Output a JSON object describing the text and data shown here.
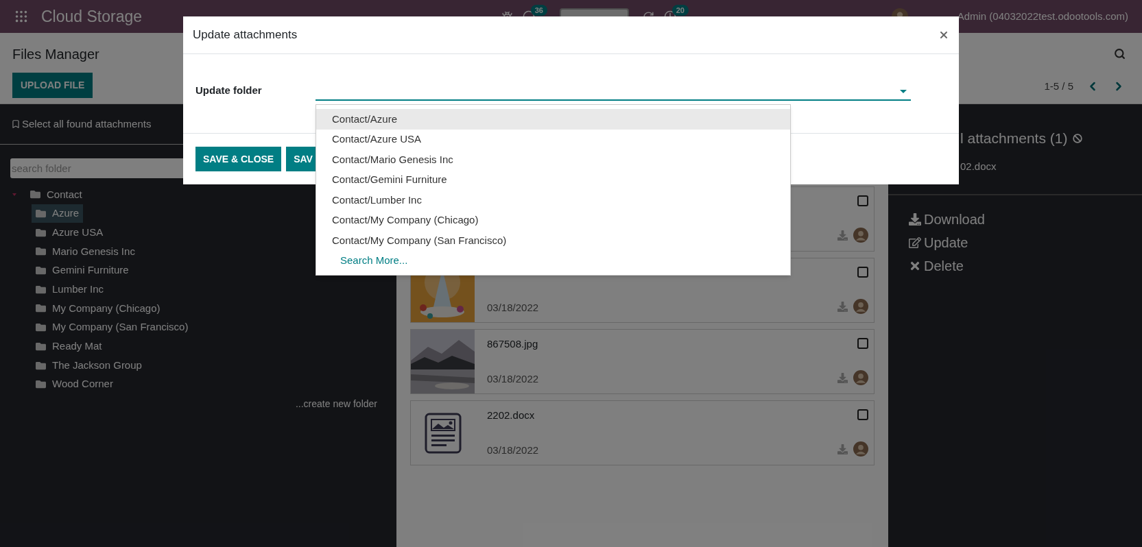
{
  "top_bar": {
    "app_title": "Cloud Storage",
    "badges": [
      {
        "kind": "chat",
        "count": "36"
      },
      {
        "kind": "activity",
        "count": "20"
      }
    ],
    "user": "Admin (04032022test.odootools.com)"
  },
  "control_panel": {
    "title": "Files Manager",
    "upload_button": "UPLOAD FILE",
    "pager": "1-5 / 5"
  },
  "folder_panel": {
    "select_all": "Select all found attachments",
    "search": {
      "placeholder": "search folder"
    },
    "tree": [
      {
        "label": "Contact",
        "expanded": true,
        "selected": false,
        "children": [
          {
            "label": "Azure",
            "selected": true
          },
          {
            "label": "Azure USA",
            "selected": false
          },
          {
            "label": "Mario Genesis Inc",
            "selected": false
          },
          {
            "label": "Gemini Furniture",
            "selected": false
          },
          {
            "label": "Lumber Inc",
            "selected": false
          },
          {
            "label": "My Company (Chicago)",
            "selected": false
          },
          {
            "label": "My Company (San Francisco)",
            "selected": false
          },
          {
            "label": "Ready Mat",
            "selected": false
          },
          {
            "label": "The Jackson Group",
            "selected": false
          },
          {
            "label": "Wood Corner",
            "selected": false
          }
        ]
      }
    ],
    "create_link": "...create new folder"
  },
  "attachments": [
    {
      "checked": false
    },
    {
      "kind": "picture",
      "date": "03/18/2022",
      "checked": false
    },
    {
      "kind": "picture",
      "name": "867508.jpg",
      "date": "03/18/2022",
      "checked": false
    },
    {
      "kind": "document",
      "name": "2202.docx",
      "date": "03/18/2022",
      "checked": false
    }
  ],
  "details": {
    "heading": "l attachments (1)",
    "file": "02.docx",
    "actions": [
      {
        "kind": "download",
        "label": "Download"
      },
      {
        "kind": "update",
        "label": "Update"
      },
      {
        "kind": "delete",
        "label": "Delete"
      }
    ]
  },
  "dialog": {
    "title": "Update attachments",
    "field_label": "Update folder",
    "options": [
      {
        "label": "Contact/Azure",
        "selected": true
      },
      {
        "label": "Contact/Azure USA",
        "selected": false
      },
      {
        "label": "Contact/Mario Genesis Inc",
        "selected": false
      },
      {
        "label": "Contact/Gemini Furniture",
        "selected": false
      },
      {
        "label": "Contact/Lumber Inc",
        "selected": false
      },
      {
        "label": "Contact/My Company (Chicago)",
        "selected": false
      },
      {
        "label": "Contact/My Company (San Francisco)",
        "selected": false
      }
    ],
    "search_more": "Search More...",
    "buttons": [
      "SAVE & CLOSE",
      "SAV"
    ]
  }
}
